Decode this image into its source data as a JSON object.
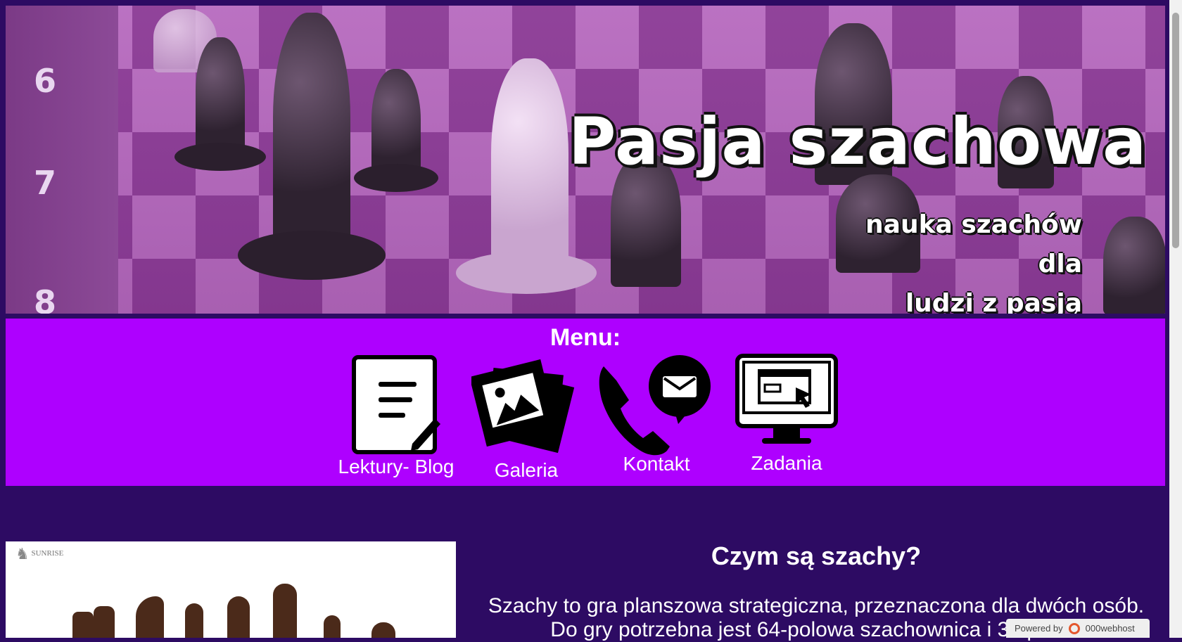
{
  "header": {
    "title": "Pasja szachowa",
    "subtitle_line1": "nauka szachów dla",
    "subtitle_line2": "ludzi z pasją",
    "rank_numbers": [
      "6",
      "7",
      "8"
    ]
  },
  "menu": {
    "heading": "Menu:",
    "items": [
      {
        "label": "Lektury- Blog",
        "icon": "document-edit-icon"
      },
      {
        "label": "Galeria",
        "icon": "photo-gallery-icon"
      },
      {
        "label": "Kontakt",
        "icon": "phone-mail-icon"
      },
      {
        "label": "Zadania",
        "icon": "monitor-cursor-icon"
      }
    ]
  },
  "content": {
    "image_logo_text": "SUNRISE",
    "heading": "Czym są szachy?",
    "paragraph_line1": "Szachy to gra planszowa strategiczna, przeznaczona dla dwóch osób.",
    "paragraph_line2": "Do gry potrzebna jest 64-polowa szachownica i 32 pionki"
  },
  "badge": {
    "prefix": "Powered by",
    "brand": "000webhost"
  },
  "colors": {
    "page_background": "#2d0b63",
    "menu_background": "#ae00ff",
    "text": "#ffffff"
  }
}
